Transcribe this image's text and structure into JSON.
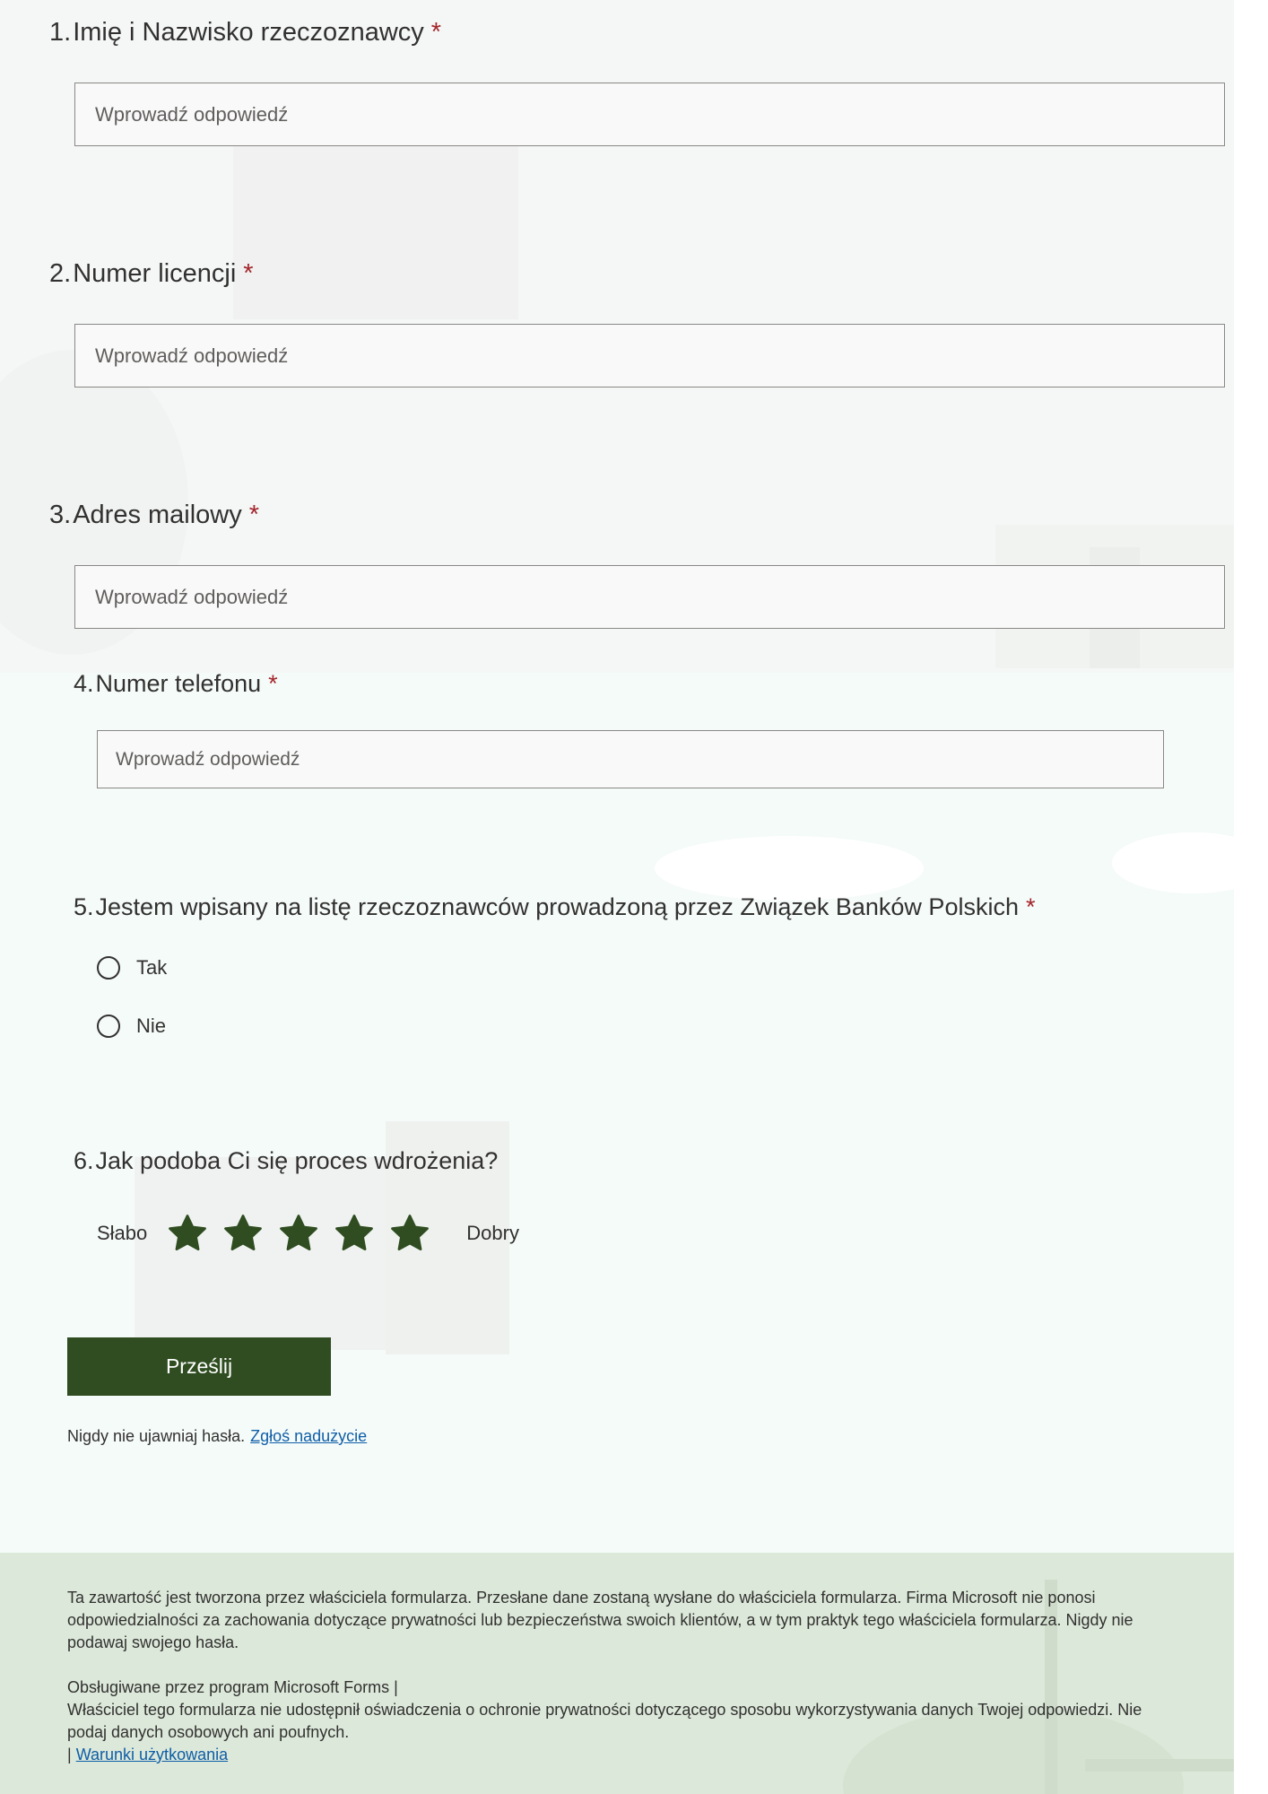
{
  "questions": [
    {
      "number": "1.",
      "label": "Imię i Nazwisko rzeczoznawcy",
      "required_mark": "*",
      "placeholder": "Wprowadź odpowiedź"
    },
    {
      "number": "2.",
      "label": "Numer licencji",
      "required_mark": "*",
      "placeholder": "Wprowadź odpowiedź"
    },
    {
      "number": "3.",
      "label": "Adres mailowy",
      "required_mark": "*",
      "placeholder": "Wprowadź odpowiedź"
    },
    {
      "number": "4.",
      "label": "Numer telefonu",
      "required_mark": "*",
      "placeholder": "Wprowadź odpowiedź"
    },
    {
      "number": "5.",
      "label": "Jestem wpisany na listę rzeczoznawców prowadzoną przez Związek Banków Polskich",
      "required_mark": "*",
      "options": [
        "Tak",
        "Nie"
      ]
    },
    {
      "number": "6.",
      "label": "Jak podoba Ci się proces wdrożenia?",
      "rating": {
        "low_label": "Słabo",
        "high_label": "Dobry",
        "max": 5,
        "selected": 0
      }
    }
  ],
  "submit_label": "Prześlij",
  "note": {
    "text": "Nigdy nie ujawniaj hasła.",
    "link": "Zgłoś nadużycie"
  },
  "footer": {
    "disclaimer": "Ta zawartość jest tworzona przez właściciela formularza. Przesłane dane zostaną wysłane do właściciela formularza. Firma Microsoft nie ponosi odpowiedzialności za zachowania dotyczące prywatności lub bezpieczeństwa swoich klientów, a w tym praktyk tego właściciela formularza. Nigdy nie podawaj swojego hasła.",
    "powered_by": "Obsługiwane przez program Microsoft Forms |",
    "privacy_note": "Właściciel tego formularza nie udostępnił oświadczenia o ochronie prywatności dotyczącego sposobu wykorzystywania danych Twojej odpowiedzi. Nie podaj danych osobowych ani poufnych.",
    "terms_prefix": "|",
    "terms_link": "Warunki użytkowania"
  },
  "colors": {
    "accent": "#2f4d20",
    "required": "#a4262c",
    "link": "#0f5ea8",
    "footer_bg": "#dce8d9"
  }
}
